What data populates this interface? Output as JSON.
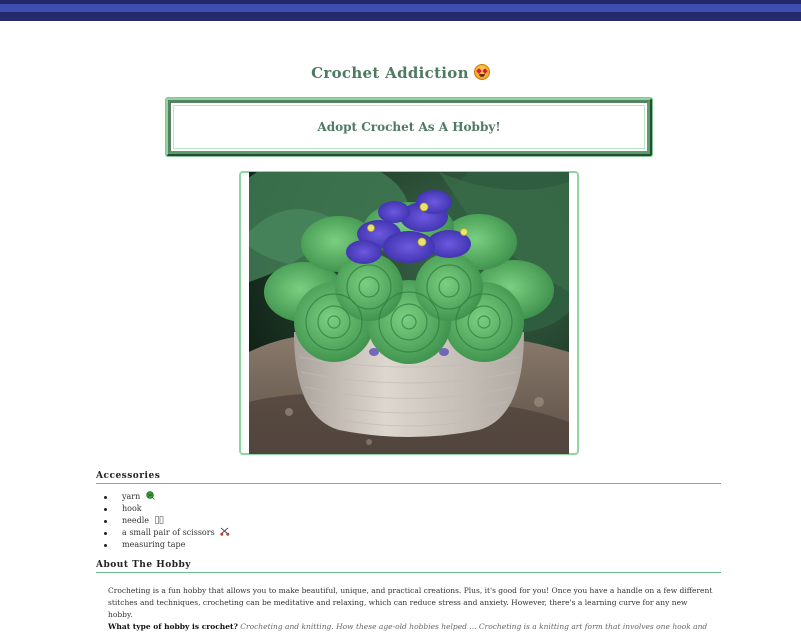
{
  "page": {
    "title": "Crochet Addiction",
    "title_emoji": "star-struck-face",
    "banner": "Adopt Crochet As A Hobby!"
  },
  "photo": {
    "subject": "crocheted-african-violet-pot"
  },
  "accessories": {
    "heading": "Accessories",
    "items": [
      {
        "label": "yarn",
        "icon": "yarn-ball-icon"
      },
      {
        "label": "hook",
        "icon": ""
      },
      {
        "label": "needle",
        "icon": "needle-icon"
      },
      {
        "label": "a small pair of scissors",
        "icon": "scissors-icon"
      },
      {
        "label": "measuring tape",
        "icon": ""
      }
    ]
  },
  "about": {
    "heading": "About The Hobby",
    "paragraph_line1": "Crocheting is a fun hobby that allows you to make beautiful, unique, and practical creations. Plus, it's good for you! Once you have a handle on a few different",
    "paragraph_line2": "stitches and techniques, crocheting can be meditative and relaxing, which can reduce stress and anxiety. However, there's a learning curve for any new hobby.",
    "question": "What type of hobby is crochet?",
    "answer_start": "Crocheting and knitting. How these age-old hobbies helped ... Crocheting is a knitting art form that involves one hook and"
  },
  "colors": {
    "accent_green": "#4f7a62",
    "border_green": "#8fd6a1",
    "topbar_dark": "#23296a",
    "topbar_light": "#3e4fb1"
  }
}
